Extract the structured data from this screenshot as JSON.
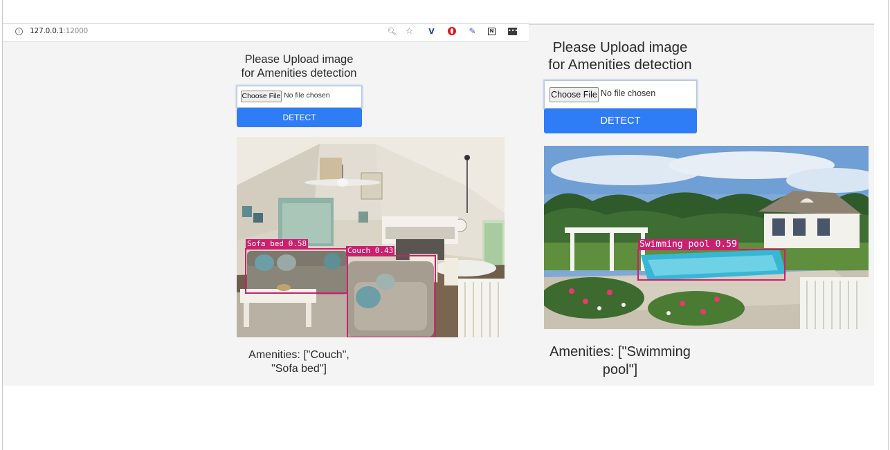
{
  "browser": {
    "url_host": "127.0.0.1",
    "url_port": ":12000",
    "toolbar_icons": [
      "zoom-icon",
      "bookmark-star-icon",
      "v-extension-icon",
      "opera-extension-icon",
      "quill-extension-icon",
      "notion-extension-icon",
      "extensions-menu-icon"
    ]
  },
  "left": {
    "title": "Please Upload image for Amenities detection",
    "choose_file_label": "Choose File",
    "no_file_text": "No file chosen",
    "detect_label": "DETECT",
    "detections": [
      {
        "label": "Sofa bed 0.58"
      },
      {
        "label": "Couch 0.43"
      }
    ],
    "amenities_text": "Amenities: [\"Couch\", \"Sofa bed\"]"
  },
  "right": {
    "title": "Please Upload image for Amenities detection",
    "choose_file_label": "Choose File",
    "no_file_text": "No file chosen",
    "detect_label": "DETECT",
    "detections": [
      {
        "label": "Swimming pool 0.59"
      }
    ],
    "amenities_text": "Amenities: [\"Swimming pool\"]"
  },
  "colors": {
    "detect_button": "#2e7cf6",
    "bbox": "#cc1f6f",
    "page_background": "#f4f4f4"
  }
}
